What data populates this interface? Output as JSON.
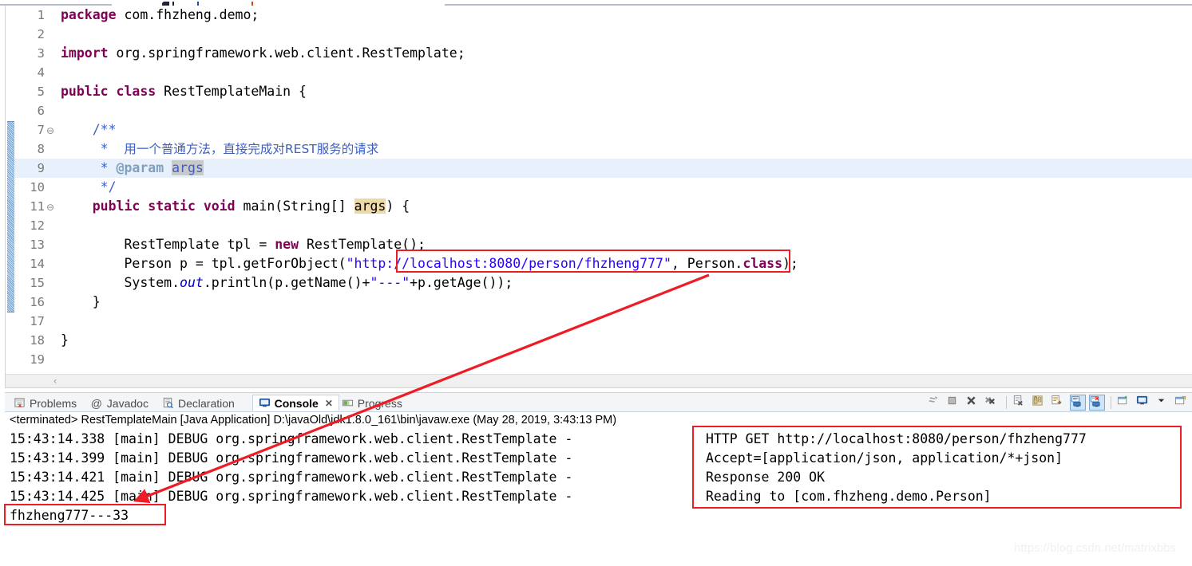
{
  "editor": {
    "language": "java",
    "lines": [
      {
        "n": "1",
        "fold": "",
        "highlight": false,
        "tokens": [
          {
            "t": "package",
            "c": "kw"
          },
          {
            "t": " com.fhzheng.demo;",
            "c": "plain"
          }
        ]
      },
      {
        "n": "2",
        "fold": "",
        "highlight": false,
        "tokens": []
      },
      {
        "n": "3",
        "fold": "",
        "highlight": false,
        "tokens": [
          {
            "t": "import",
            "c": "kw"
          },
          {
            "t": " org.springframework.web.client.RestTemplate;",
            "c": "plain"
          }
        ]
      },
      {
        "n": "4",
        "fold": "",
        "highlight": false,
        "tokens": []
      },
      {
        "n": "5",
        "fold": "",
        "highlight": false,
        "tokens": [
          {
            "t": "public",
            "c": "kw"
          },
          {
            "t": " ",
            "c": "plain"
          },
          {
            "t": "class",
            "c": "kw"
          },
          {
            "t": " RestTemplateMain {",
            "c": "plain"
          }
        ]
      },
      {
        "n": "6",
        "fold": "",
        "highlight": false,
        "tokens": []
      },
      {
        "n": "7",
        "fold": "⊖",
        "highlight": false,
        "tokens": [
          {
            "t": "    ",
            "c": "plain"
          },
          {
            "t": "/**",
            "c": "jdoc"
          }
        ]
      },
      {
        "n": "8",
        "fold": "",
        "highlight": false,
        "tokens": [
          {
            "t": "     * ",
            "c": "jdoc"
          },
          {
            "t": "  用一个普通方法，直接完成对REST服务的请求",
            "c": "jdoc cjk"
          }
        ]
      },
      {
        "n": "9",
        "fold": "",
        "highlight": true,
        "tokens": [
          {
            "t": "     * ",
            "c": "jdoc"
          },
          {
            "t": "@param",
            "c": "jtag"
          },
          {
            "t": " ",
            "c": "jdoc"
          },
          {
            "t": "args",
            "c": "jdoc param-hl"
          }
        ]
      },
      {
        "n": "10",
        "fold": "",
        "highlight": false,
        "tokens": [
          {
            "t": "     */",
            "c": "jdoc"
          }
        ]
      },
      {
        "n": "11",
        "fold": "⊖",
        "highlight": false,
        "tokens": [
          {
            "t": "    ",
            "c": "plain"
          },
          {
            "t": "public",
            "c": "kw"
          },
          {
            "t": " ",
            "c": "plain"
          },
          {
            "t": "static",
            "c": "kw"
          },
          {
            "t": " ",
            "c": "plain"
          },
          {
            "t": "void",
            "c": "kw"
          },
          {
            "t": " main(String[] ",
            "c": "plain"
          },
          {
            "t": "args",
            "c": "plain param-occ"
          },
          {
            "t": ") {",
            "c": "plain"
          }
        ]
      },
      {
        "n": "12",
        "fold": "",
        "highlight": false,
        "tokens": []
      },
      {
        "n": "13",
        "fold": "",
        "highlight": false,
        "tokens": [
          {
            "t": "        RestTemplate tpl = ",
            "c": "plain"
          },
          {
            "t": "new",
            "c": "kw"
          },
          {
            "t": " RestTemplate();",
            "c": "plain"
          }
        ]
      },
      {
        "n": "14",
        "fold": "",
        "highlight": false,
        "tokens": [
          {
            "t": "        Person p = tpl.getForObject(",
            "c": "plain"
          },
          {
            "t": "\"http://localhost:8080/person/fhzheng777\"",
            "c": "str"
          },
          {
            "t": ", Person.",
            "c": "plain"
          },
          {
            "t": "class",
            "c": "kw"
          },
          {
            "t": ");",
            "c": "plain"
          }
        ]
      },
      {
        "n": "15",
        "fold": "",
        "highlight": false,
        "tokens": [
          {
            "t": "        System.",
            "c": "plain"
          },
          {
            "t": "out",
            "c": "fld"
          },
          {
            "t": ".println(p.getName()+",
            "c": "plain"
          },
          {
            "t": "\"---\"",
            "c": "str"
          },
          {
            "t": "+p.getAge());",
            "c": "plain"
          }
        ]
      },
      {
        "n": "16",
        "fold": "",
        "highlight": false,
        "tokens": [
          {
            "t": "    }",
            "c": "plain"
          }
        ]
      },
      {
        "n": "17",
        "fold": "",
        "highlight": false,
        "tokens": []
      },
      {
        "n": "18",
        "fold": "",
        "highlight": false,
        "tokens": [
          {
            "t": "}",
            "c": "plain"
          }
        ]
      },
      {
        "n": "19",
        "fold": "",
        "highlight": false,
        "tokens": []
      }
    ],
    "scrollbar_left_arrow": "‹"
  },
  "view_tabs": [
    {
      "label": "Problems",
      "icon": "problems-icon",
      "active": false,
      "closable": false
    },
    {
      "label": "Javadoc",
      "icon": "javadoc-at-icon",
      "active": false,
      "closable": false
    },
    {
      "label": "Declaration",
      "icon": "declaration-icon",
      "active": false,
      "closable": false
    },
    {
      "label": "Console",
      "icon": "console-icon",
      "active": true,
      "closable": true,
      "close_glyph": "✕"
    },
    {
      "label": "Progress",
      "icon": "progress-icon",
      "active": false,
      "closable": false
    }
  ],
  "console_toolbar": [
    {
      "name": "terminate-and-relaunch-icon",
      "pressed": false
    },
    {
      "name": "terminate-icon",
      "pressed": false
    },
    {
      "name": "remove-launch-icon",
      "pressed": false
    },
    {
      "name": "remove-all-terminated-icon",
      "pressed": false
    },
    {
      "name": "separator",
      "pressed": false
    },
    {
      "name": "clear-console-icon",
      "pressed": false
    },
    {
      "name": "scroll-lock-icon",
      "pressed": false
    },
    {
      "name": "word-wrap-icon",
      "pressed": false
    },
    {
      "name": "show-console-on-output-icon",
      "pressed": true
    },
    {
      "name": "show-console-on-error-icon",
      "pressed": true
    },
    {
      "name": "separator",
      "pressed": false
    },
    {
      "name": "pin-console-icon",
      "pressed": false
    },
    {
      "name": "display-selected-console-icon",
      "pressed": false
    },
    {
      "name": "console-dropdown-icon",
      "pressed": false
    },
    {
      "name": "open-console-icon",
      "pressed": false
    }
  ],
  "console": {
    "terminated_line": "<terminated> RestTemplateMain [Java Application] D:\\javaOld\\jdk1.8.0_161\\bin\\javaw.exe (May 28, 2019, 3:43:13 PM)",
    "log_rows": [
      {
        "left": "15:43:14.338 [main] DEBUG org.springframework.web.client.RestTemplate - ",
        "right": "HTTP GET http://localhost:8080/person/fhzheng777"
      },
      {
        "left": "15:43:14.399 [main] DEBUG org.springframework.web.client.RestTemplate - ",
        "right": "Accept=[application/json, application/*+json]"
      },
      {
        "left": "15:43:14.421 [main] DEBUG org.springframework.web.client.RestTemplate - ",
        "right": "Response 200 OK"
      },
      {
        "left": "15:43:14.425 [main] DEBUG org.springframework.web.client.RestTemplate - ",
        "right": "Reading to [com.fhzheng.demo.Person]"
      }
    ],
    "program_output": "fhzheng777---33"
  },
  "annotations": {
    "highlight_color": "#ee1c25",
    "boxes": [
      {
        "name": "url-literal-highlight-box"
      },
      {
        "name": "response-detail-highlight-box"
      },
      {
        "name": "program-output-highlight-box"
      }
    ],
    "arrow": {
      "name": "url-to-output-arrow"
    }
  },
  "watermark": "https://blog.csdn.net/matrixbbs"
}
